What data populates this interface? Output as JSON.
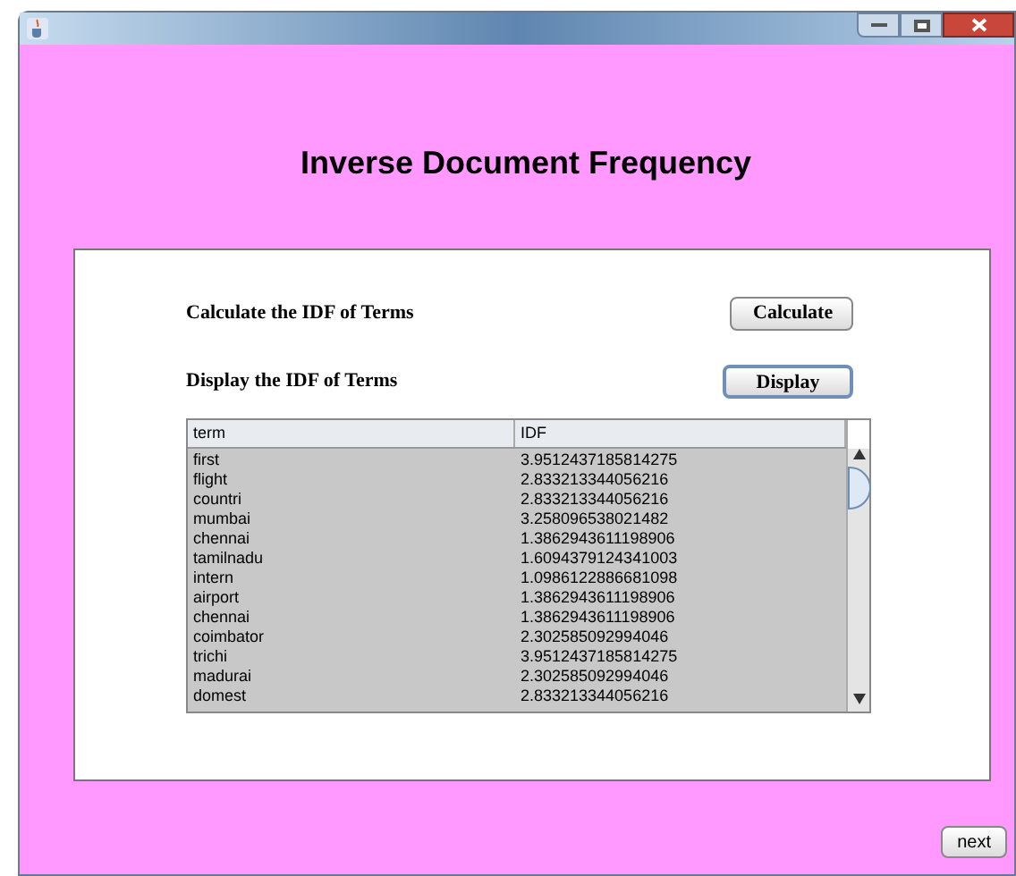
{
  "heading": "Inverse Document Frequency",
  "actions": [
    {
      "label": "Calculate the IDF of Terms",
      "button": "Calculate",
      "selected": false
    },
    {
      "label": "Display the IDF of Terms",
      "button": "Display",
      "selected": true
    }
  ],
  "table": {
    "columns": [
      "term",
      "IDF"
    ],
    "rows": [
      [
        "first",
        "3.9512437185814275"
      ],
      [
        "flight",
        "2.833213344056216"
      ],
      [
        "countri",
        "2.833213344056216"
      ],
      [
        "mumbai",
        "3.258096538021482"
      ],
      [
        "chennai",
        "1.3862943611198906"
      ],
      [
        "tamilnadu",
        "1.6094379124341003"
      ],
      [
        "intern",
        "1.0986122886681098"
      ],
      [
        "airport",
        "1.3862943611198906"
      ],
      [
        "chennai",
        "1.3862943611198906"
      ],
      [
        "coimbator",
        "2.302585092994046"
      ],
      [
        "trichi",
        "3.9512437185814275"
      ],
      [
        "madurai",
        "2.302585092994046"
      ],
      [
        "domest",
        "2.833213344056216"
      ]
    ]
  },
  "next_button": "next"
}
